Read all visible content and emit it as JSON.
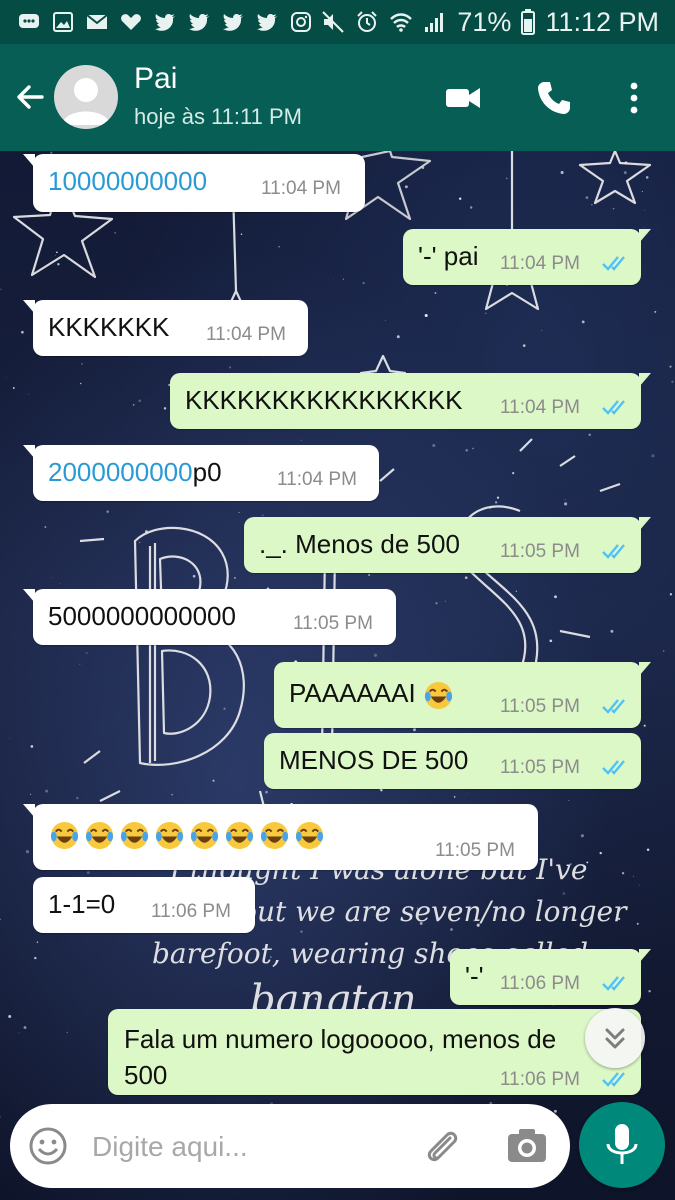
{
  "status_bar": {
    "battery": "71%",
    "time": "11:12 PM",
    "left_icons": [
      "chat-bubble-icon",
      "image-icon",
      "gmail-icon",
      "heart-icon",
      "twitter-icon",
      "twitter-icon",
      "twitter-icon",
      "twitter-icon",
      "instagram-icon"
    ],
    "right_icons": [
      "mute-icon",
      "alarm-icon",
      "wifi-icon",
      "signal-icon"
    ]
  },
  "header": {
    "contact_name": "Pai",
    "last_seen": "hoje às 11:11 PM",
    "icons": [
      "back-arrow-icon",
      "video-call-icon",
      "phone-call-icon",
      "more-vert-icon"
    ]
  },
  "colors": {
    "header": "#075e54",
    "status_bar": "#054d44",
    "incoming_bubble": "#ffffff",
    "outgoing_bubble": "#dcf8c6",
    "link_number": "#2a9ad6",
    "read_ticks": "#4fc3f7",
    "mic_button": "#00897b"
  },
  "messages": [
    {
      "dir": "in",
      "text": "10000000000",
      "text_suffix": "",
      "number_link": true,
      "time": "11:04 PM"
    },
    {
      "dir": "out",
      "text": "'-' pai",
      "time": "11:04 PM",
      "ticks": "read"
    },
    {
      "dir": "in",
      "text": "KKKKKKK",
      "time": "11:04 PM"
    },
    {
      "dir": "out",
      "text": "KKKKKKKKKKKKKKKK",
      "time": "11:04 PM",
      "ticks": "read"
    },
    {
      "dir": "in",
      "text": "2000000000",
      "text_suffix": "p0",
      "number_link": true,
      "time": "11:04 PM"
    },
    {
      "dir": "out",
      "text": "._. Menos de 500",
      "time": "11:05 PM",
      "ticks": "read"
    },
    {
      "dir": "in",
      "text": "5000000000000",
      "time": "11:05 PM"
    },
    {
      "dir": "out",
      "text": "PAAAAAAI",
      "emoji": "face-with-tears-of-joy",
      "emoji_count": 1,
      "time": "11:05 PM",
      "ticks": "read"
    },
    {
      "dir": "out",
      "text": "MENOS DE 500",
      "time": "11:05 PM",
      "ticks": "read"
    },
    {
      "dir": "in",
      "text": "",
      "emoji": "face-with-tears-of-joy",
      "emoji_count": 8,
      "time": "11:05 PM"
    },
    {
      "dir": "in",
      "text": "1-1=0",
      "time": "11:06 PM"
    },
    {
      "dir": "out",
      "text": "'-'",
      "time": "11:06 PM",
      "ticks": "read"
    },
    {
      "dir": "out",
      "text_line1": "Fala um numero logooooo, menos de",
      "text_line2": "500",
      "time": "11:06 PM",
      "ticks": "read"
    }
  ],
  "wallpaper_text": {
    "line1": "I thought I was alone but I've",
    "line2": "found out we are seven/no longer",
    "line3": "barefoot, wearing shoes called",
    "line4": "bangtan"
  },
  "input": {
    "placeholder": "Digite aqui...",
    "value": ""
  }
}
